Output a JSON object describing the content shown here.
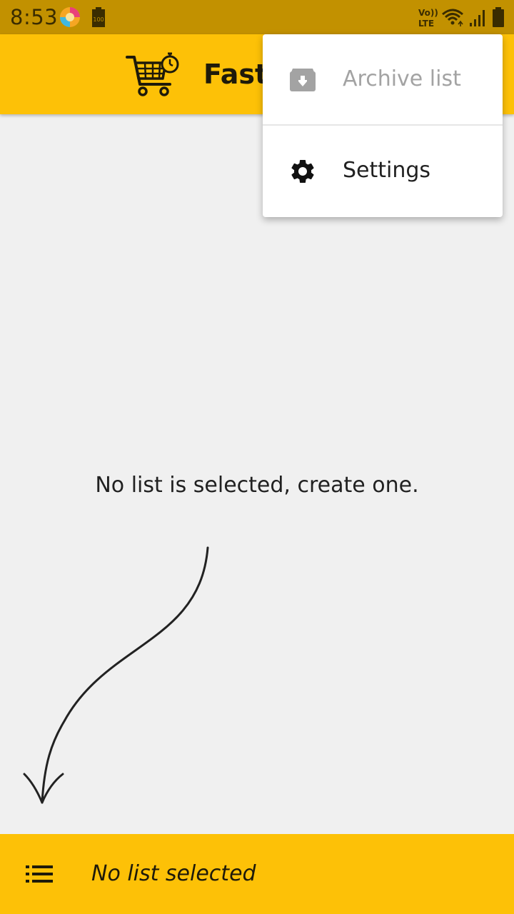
{
  "status_bar": {
    "time": "8:53",
    "icons": [
      "app-notification-icon",
      "battery-saver-icon",
      "volte-icon",
      "wifi-icon",
      "signal-icon",
      "battery-icon"
    ],
    "battery_badge": "100",
    "volte_text": "Vo))",
    "lte_text": "LTE"
  },
  "app_bar": {
    "title": "Fast",
    "logo_icon": "cart-stopwatch-icon"
  },
  "overflow_menu": {
    "items": [
      {
        "label": "Archive list",
        "icon": "archive-icon",
        "enabled": false
      },
      {
        "label": "Settings",
        "icon": "gear-icon",
        "enabled": true
      }
    ]
  },
  "main": {
    "empty_message": "No list is selected, create one."
  },
  "bottom_bar": {
    "menu_icon": "list-icon",
    "label": "No list selected"
  },
  "colors": {
    "accent": "#fdc107",
    "status_bar": "#c29100",
    "background": "#f0f0f0",
    "disabled_text": "#a3a3a3"
  }
}
